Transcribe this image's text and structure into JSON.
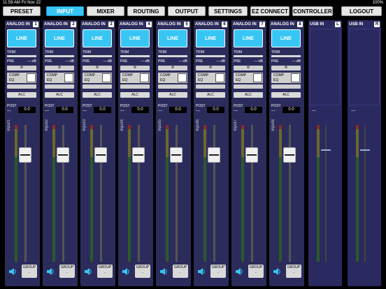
{
  "status": {
    "time": "11:59 AM",
    "date": "Fri Nov 22",
    "battery": "100%"
  },
  "nav": {
    "preset": "PRESET",
    "input": "INPUT",
    "mixer": "MIXER",
    "routing": "ROUTING",
    "output": "OUTPUT",
    "settings": "SETTINGS",
    "ezconnect": "EZ CONNECT",
    "controller": "CONTROLLER",
    "logout": "LOGOUT"
  },
  "analog": [
    {
      "header": "ANALOG IN",
      "num": "1",
      "line": "LINE",
      "trim": "TRIM",
      "pre": "PRE",
      "pre_val": "----dB",
      "phase": "Φ",
      "comp": "COMP",
      "eq": "EQ",
      "alc": "ALC",
      "post": "POST",
      "post_dash": "---",
      "post_val": "0.0",
      "channel": "Input1",
      "group": "GROUP",
      "group_sub": "-"
    },
    {
      "header": "ANALOG IN",
      "num": "2",
      "line": "LINE",
      "trim": "TRIM",
      "pre": "PRE",
      "pre_val": "----dB",
      "phase": "Φ",
      "comp": "COMP",
      "eq": "EQ",
      "alc": "ALC",
      "post": "POST",
      "post_dash": "---",
      "post_val": "0.0",
      "channel": "Input2",
      "group": "GROUP",
      "group_sub": "-"
    },
    {
      "header": "ANALOG IN",
      "num": "3",
      "line": "LINE",
      "trim": "TRIM",
      "pre": "PRE",
      "pre_val": "----dB",
      "phase": "Φ",
      "comp": "COMP",
      "eq": "EQ",
      "alc": "ALC",
      "post": "POST",
      "post_dash": "---",
      "post_val": "0.0",
      "channel": "Input3",
      "group": "GROUP",
      "group_sub": "-"
    },
    {
      "header": "ANALOG IN",
      "num": "4",
      "line": "LINE",
      "trim": "TRIM",
      "pre": "PRE",
      "pre_val": "----dB",
      "phase": "Φ",
      "comp": "COMP",
      "eq": "EQ",
      "alc": "ALC",
      "post": "POST",
      "post_dash": "---",
      "post_val": "0.0",
      "channel": "Input4",
      "group": "GROUP",
      "group_sub": "-"
    },
    {
      "header": "ANALOG IN",
      "num": "5",
      "line": "LINE",
      "trim": "TRIM",
      "pre": "PRE",
      "pre_val": "----dB",
      "phase": "Φ",
      "comp": "COMP",
      "eq": "EQ",
      "alc": "ALC",
      "post": "POST",
      "post_dash": "---",
      "post_val": "0.0",
      "channel": "Input5",
      "group": "GROUP",
      "group_sub": "-"
    },
    {
      "header": "ANALOG IN",
      "num": "6",
      "line": "LINE",
      "trim": "TRIM",
      "pre": "PRE",
      "pre_val": "----dB",
      "phase": "Φ",
      "comp": "COMP",
      "eq": "EQ",
      "alc": "ALC",
      "post": "POST",
      "post_dash": "---",
      "post_val": "0.0",
      "channel": "Input6",
      "group": "GROUP",
      "group_sub": "-"
    },
    {
      "header": "ANALOG IN",
      "num": "7",
      "line": "LINE",
      "trim": "TRIM",
      "pre": "PRE",
      "pre_val": "----dB",
      "phase": "Φ",
      "comp": "COMP",
      "eq": "EQ",
      "alc": "ALC",
      "post": "POST",
      "post_dash": "---",
      "post_val": "0.0",
      "channel": "Input7",
      "group": "GROUP",
      "group_sub": "-"
    },
    {
      "header": "ANALOG IN",
      "num": "8",
      "line": "LINE",
      "trim": "TRIM",
      "pre": "PRE",
      "pre_val": "----dB",
      "phase": "Φ",
      "comp": "COMP",
      "eq": "EQ",
      "alc": "ALC",
      "post": "POST",
      "post_dash": "---",
      "post_val": "0.0",
      "channel": "Input8",
      "group": "GROUP",
      "group_sub": "-"
    }
  ],
  "usb": [
    {
      "header": "USB IN",
      "num": "L",
      "dash": "---"
    },
    {
      "header": "USB IN",
      "num": "R",
      "dash": "---"
    }
  ]
}
